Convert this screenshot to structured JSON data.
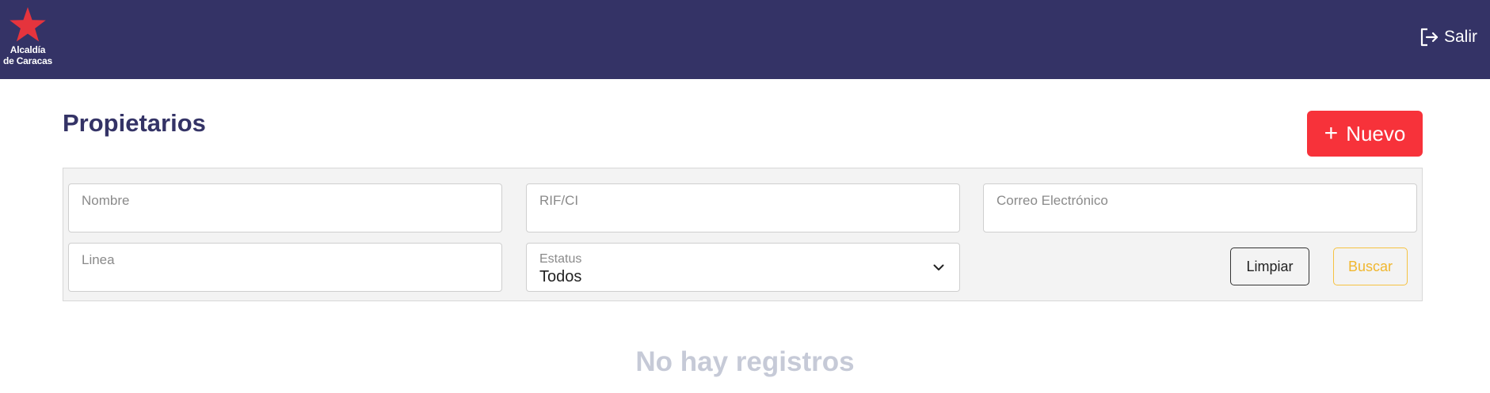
{
  "header": {
    "logo_line1": "Alcaldía",
    "logo_line2": "de Caracas",
    "logout_label": "Salir",
    "background": "#343366"
  },
  "page": {
    "title": "Propietarios",
    "new_button_label": "Nuevo"
  },
  "filters": {
    "nombre_placeholder": "Nombre",
    "rif_placeholder": "RIF/CI",
    "correo_placeholder": "Correo Electrónico",
    "linea_placeholder": "Linea",
    "estatus_label": "Estatus",
    "estatus_value": "Todos",
    "clear_label": "Limpiar",
    "search_label": "Buscar"
  },
  "results": {
    "empty_message": "No hay registros"
  },
  "colors": {
    "brand_navy": "#343366",
    "accent_red": "#f7323a",
    "search_yellow": "#f0b72f",
    "empty_text": "#c6cad7"
  }
}
